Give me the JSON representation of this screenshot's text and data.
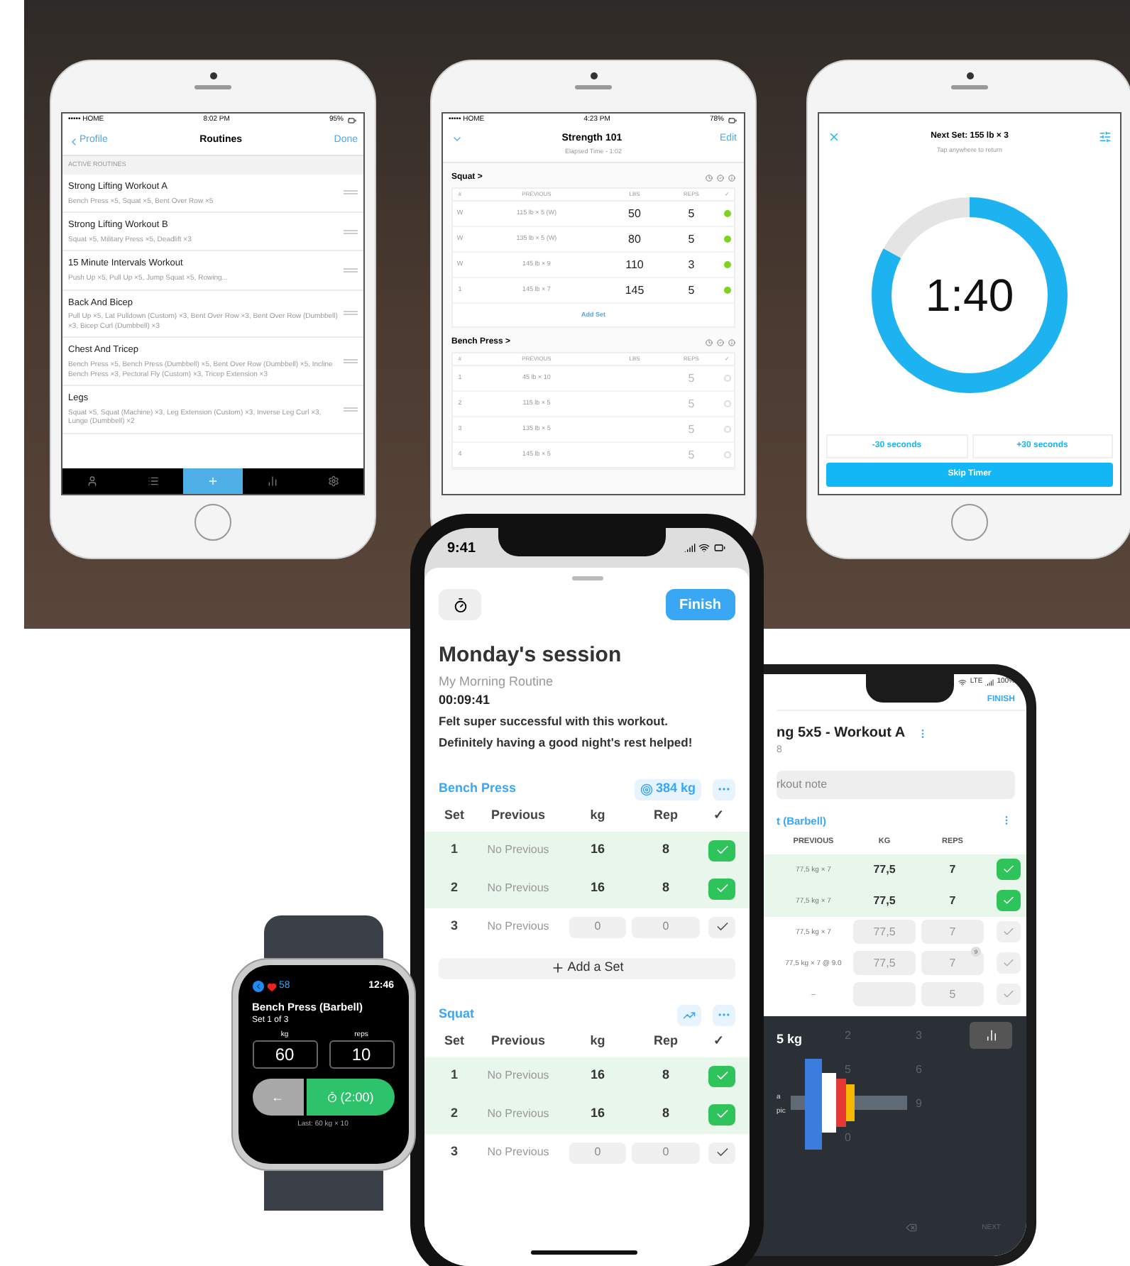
{
  "routines_phone": {
    "status": {
      "carrier": "••••• HOME",
      "time": "8:02 PM",
      "battery": "95%"
    },
    "nav": {
      "back": "Profile",
      "title": "Routines",
      "action": "Done"
    },
    "section": "ACTIVE ROUTINES",
    "routines": [
      {
        "name": "Strong Lifting Workout A",
        "exercises": "Bench Press ×5, Squat ×5, Bent Over Row ×5"
      },
      {
        "name": "Strong Lifting Workout B",
        "exercises": "Squat ×5, Military Press ×5, Deadlift ×3"
      },
      {
        "name": "15 Minute Intervals Workout",
        "exercises": "Push Up ×5, Pull Up ×5, Jump Squat ×5, Rowing..."
      },
      {
        "name": "Back And Bicep",
        "exercises": "Pull Up ×5, Lat Pulldown (Custom) ×3, Bent Over Row ×3, Bent Over Row (Dumbbell) ×3, Bicep Curl (Dumbbell) ×3"
      },
      {
        "name": "Chest And Tricep",
        "exercises": "Bench Press ×5, Bench Press (Dumbbell) ×5, Bent Over Row (Dumbbell) ×5, Incline Bench Press ×3, Pectoral Fly (Custom) ×3, Tricep Extension ×3"
      },
      {
        "name": "Legs",
        "exercises": "Squat ×5, Squat (Machine) ×3, Leg Extension (Custom) ×3, Inverse Leg Curl ×3, Lunge (Dumbbell) ×2"
      }
    ],
    "tabs": [
      {
        "kind": "profile",
        "selected": false
      },
      {
        "kind": "list",
        "selected": false
      },
      {
        "kind": "add",
        "selected": true
      },
      {
        "kind": "chart",
        "selected": false
      },
      {
        "kind": "settings",
        "selected": false
      }
    ]
  },
  "workout_phone": {
    "status": {
      "carrier": "••••• HOME",
      "time": "4:23 PM",
      "battery": "78%"
    },
    "title": "Strength 101",
    "subtitle": "Elapsed Time - 1:02",
    "action": "Edit",
    "exercises": [
      {
        "name": "Squat >",
        "columns": [
          "#",
          "PREVIOUS",
          "LBS",
          "REPS",
          "✓"
        ],
        "add_set": "Add Set",
        "sets": [
          {
            "set": "W",
            "previous": "115 lb × 5 (W)",
            "weight": "50",
            "reps": "5",
            "done": true
          },
          {
            "set": "W",
            "previous": "135 lb × 5 (W)",
            "weight": "80",
            "reps": "5",
            "done": true
          },
          {
            "set": "W",
            "previous": "145 lb × 9",
            "weight": "110",
            "reps": "3",
            "done": true
          },
          {
            "set": "1",
            "previous": "145 lb × 7",
            "weight": "145",
            "reps": "5",
            "done": true
          }
        ]
      },
      {
        "name": "Bench Press >",
        "columns": [
          "#",
          "PREVIOUS",
          "LBS",
          "REPS",
          "✓"
        ],
        "sets": [
          {
            "set": "1",
            "previous": "45 lb × 10",
            "reps": "5",
            "done": false
          },
          {
            "set": "2",
            "previous": "115 lb × 5",
            "reps": "5",
            "done": false
          },
          {
            "set": "3",
            "previous": "135 lb × 5",
            "reps": "5",
            "done": false
          },
          {
            "set": "4",
            "previous": "145 lb × 5",
            "reps": "5",
            "done": false
          }
        ]
      }
    ]
  },
  "timer_phone": {
    "title": "Next Set: 155 lb × 3",
    "hint": "Tap anywhere to return",
    "time": "1:40",
    "level": 0.83,
    "buttons": [
      "-30 seconds",
      "+30 seconds"
    ],
    "skip": "Skip Timer"
  },
  "session_phone": {
    "status": {
      "time": "9:41"
    },
    "finish": "Finish",
    "title": "Monday's session",
    "routine": "My Morning Routine",
    "duration": "00:09:41",
    "notes": "Felt super successful with this workout. Definitely having a good night's rest helped!",
    "exercises": [
      {
        "name": "Bench Press",
        "badge": "384 kg",
        "columns": [
          "Set",
          "Previous",
          "kg",
          "Rep",
          "✓"
        ],
        "add_set": "Add a Set",
        "sets": [
          {
            "set": "1",
            "previous": "No Previous",
            "kg": "16",
            "rep": "8",
            "done": true
          },
          {
            "set": "2",
            "previous": "No Previous",
            "kg": "16",
            "rep": "8",
            "done": true
          },
          {
            "set": "3",
            "previous": "No Previous",
            "kg": "0",
            "rep": "0",
            "done": false
          }
        ]
      },
      {
        "name": "Squat",
        "columns": [
          "Set",
          "Previous",
          "kg",
          "Rep",
          "✓"
        ],
        "sets": [
          {
            "set": "1",
            "previous": "No Previous",
            "kg": "16",
            "rep": "8",
            "done": true
          },
          {
            "set": "2",
            "previous": "No Previous",
            "kg": "16",
            "rep": "8",
            "done": true
          },
          {
            "set": "3",
            "previous": "No Previous",
            "kg": "0",
            "rep": "0",
            "done": false
          }
        ]
      }
    ]
  },
  "android_phone": {
    "status": {
      "network": "LTE",
      "battery": "100%"
    },
    "finish": "FINISH",
    "title": "ng 5x5 - Workout A",
    "subtitle": "8",
    "note_placeholder": "rkout note",
    "exercise": "t (Barbell)",
    "columns": [
      "PREVIOUS",
      "KG",
      "REPS"
    ],
    "sets": [
      {
        "previous": "77,5 kg × 7",
        "kg": "77,5",
        "reps": "7",
        "done": true
      },
      {
        "previous": "77,5 kg × 7",
        "kg": "77,5",
        "reps": "7",
        "done": true
      },
      {
        "previous": "77,5 kg × 7",
        "kg": "77,5",
        "reps": "7",
        "done": false
      },
      {
        "previous": "77,5 kg × 7 @ 9.0",
        "kg": "77,5",
        "reps": "7",
        "rpe": "9",
        "done": false
      },
      {
        "previous": "–",
        "reps": "5",
        "done": false
      }
    ],
    "keypad": {
      "display": "5 kg",
      "keys": [
        "2",
        "3",
        "5",
        "6",
        "9",
        "0"
      ],
      "next": "NEXT",
      "side_labels": [
        "a",
        "pic"
      ]
    }
  },
  "watch": {
    "heart_rate": "58",
    "time": "12:46",
    "title": "Bench Press (Barbell)",
    "subtitle": "Set 1 of 3",
    "fields": [
      {
        "label": "kg",
        "value": "60"
      },
      {
        "label": "reps",
        "value": "10"
      }
    ],
    "back": "←",
    "timer": "(2:00)",
    "last": "Last: 60 kg × 10"
  }
}
